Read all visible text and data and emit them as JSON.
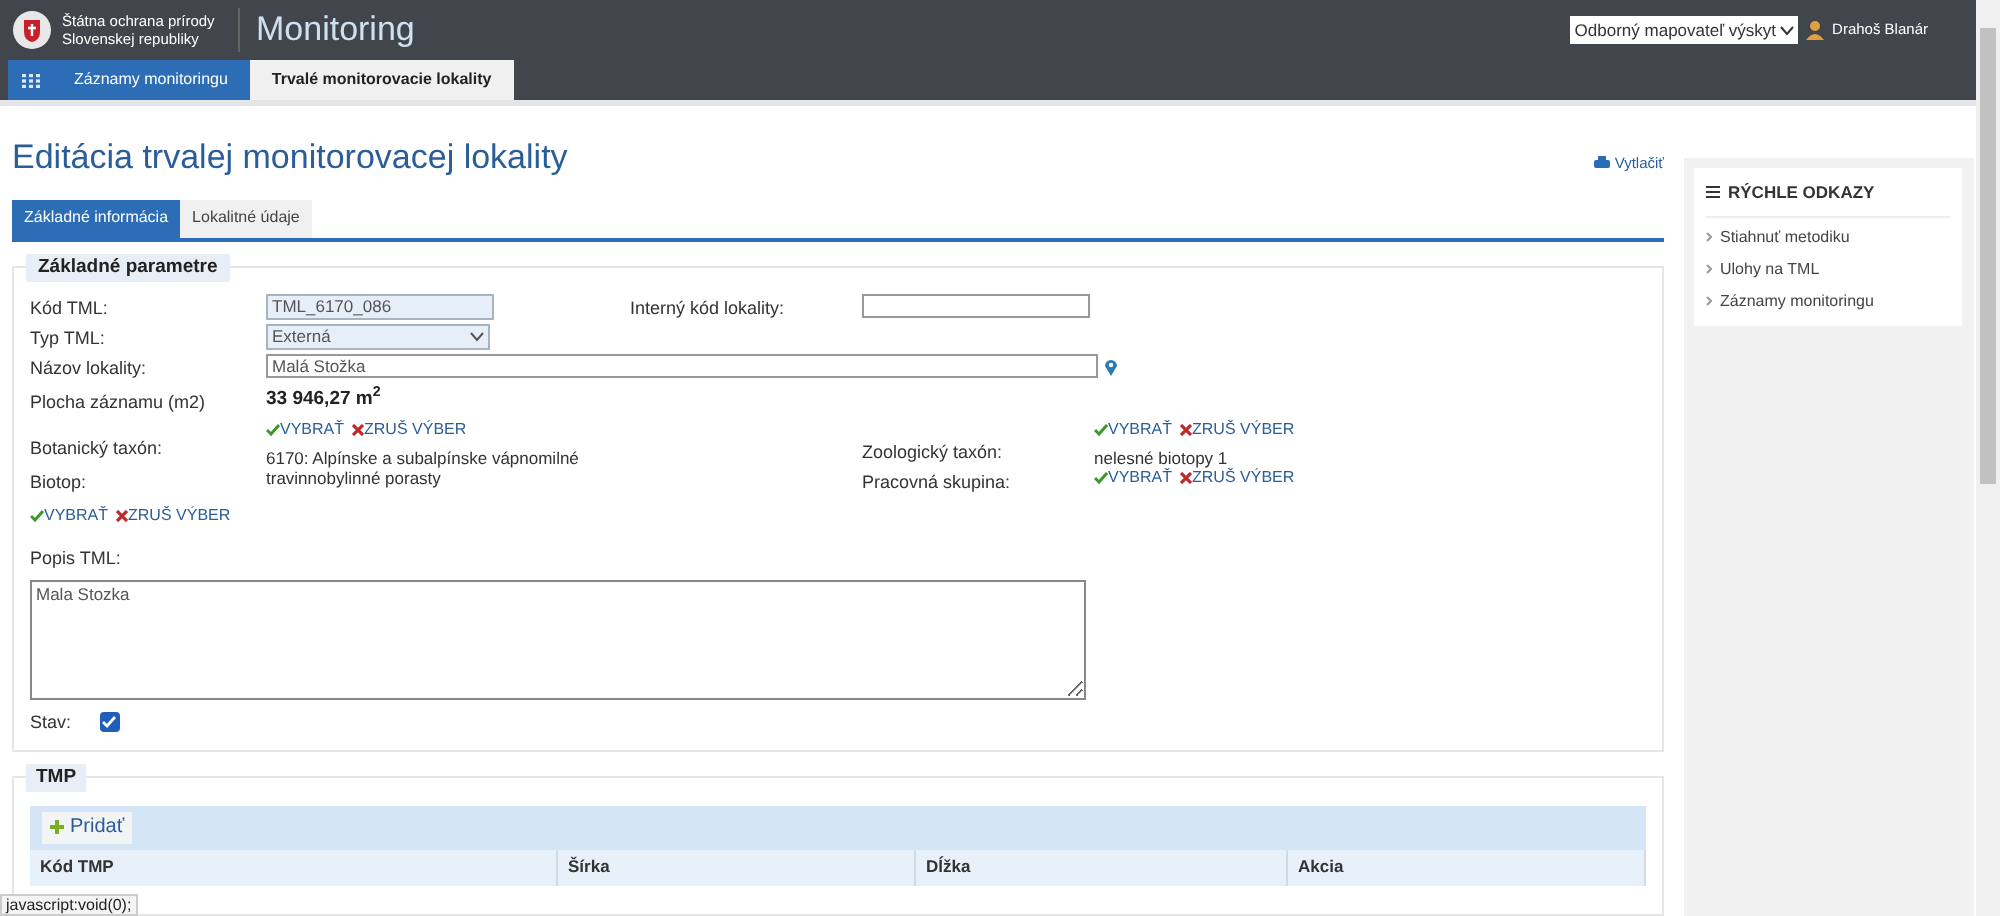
{
  "header": {
    "org_name": "Štátna ochrana prírody Slovenskej republiky",
    "app_title": "Monitoring",
    "role_select": {
      "value": "Odborný mapovateľ výskyt"
    },
    "user": "Drahoš Blanár"
  },
  "nav": [
    {
      "label": "Záznamy monitoringu",
      "selected": false
    },
    {
      "label": "Trvalé monitorovacie lokality",
      "selected": true
    }
  ],
  "page_title": "Editácia trvalej monitorovacej lokality",
  "print_link": "Vytlačiť",
  "tabs": [
    {
      "label": "Základné informácia",
      "selected": true
    },
    {
      "label": "Lokalitné údaje",
      "selected": false
    }
  ],
  "basic": {
    "legend": "Základné parametre",
    "kod_tml": {
      "label": "Kód TML:",
      "value": "TML_6170_086"
    },
    "interny_kod": {
      "label": "Interný kód lokality:"
    },
    "typ_tml": {
      "label": "Typ TML:",
      "value": "Externá"
    },
    "nazov": {
      "label": "Názov lokality:",
      "value": "Malá Stožka"
    },
    "plocha": {
      "label": "Plocha záznamu (m2)",
      "value": "33 946,27 m$^{2}$"
    },
    "botanicky": {
      "label": "Botanický taxón:",
      "select": "VYBRAŤ",
      "clear": "ZRUŠ VÝBER"
    },
    "zoologicky": {
      "label": "Zoologický taxón:",
      "select": "VYBRAŤ",
      "clear": "ZRUŠ VÝBER"
    },
    "biotop": {
      "label": "Biotop:",
      "value": "6170: Alpínske a subalpínske vápnomilné travinnobylinné porasty",
      "select": "VYBRAŤ",
      "clear": "ZRUŠ VÝBER"
    },
    "skupina": {
      "label": "Pracovná skupina:",
      "value": "nelesné biotopy 1",
      "select": "VYBRAŤ",
      "clear": "ZRUŠ VÝBER"
    },
    "popis": {
      "label": "Popis TML:",
      "value": "Mala Stozka"
    },
    "stav": {
      "label": "Stav:",
      "checked": true
    }
  },
  "tmp": {
    "legend": "TMP",
    "add_button": "Pridať",
    "columns": [
      "Kód TMP",
      "Šírka",
      "Dĺžka",
      "Akcia"
    ]
  },
  "quick_links": {
    "title": "RÝCHLE ODKAZY",
    "items": [
      "Stiahnuť metodiku",
      "Ulohy na TML",
      "Záznamy monitoringu"
    ]
  },
  "status_bar": "javascript:void(0);"
}
